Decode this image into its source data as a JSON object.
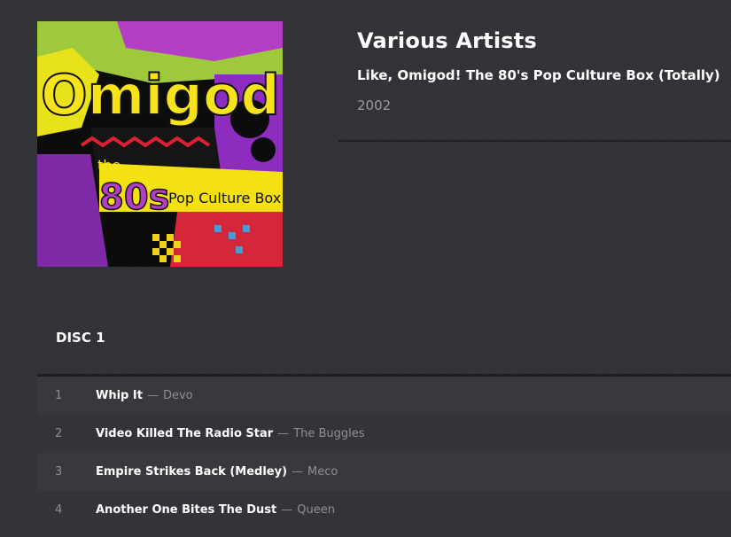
{
  "album": {
    "artist": "Various Artists",
    "title": "Like, Omigod! The 80's Pop Culture Box (Totally)",
    "year": "2002",
    "cover_text": {
      "main": "Omigod!",
      "the": "the",
      "eighties": "80s",
      "box": "Pop Culture Box"
    }
  },
  "disc": {
    "label": "DISC 1",
    "separator": "—",
    "tracks": [
      {
        "number": "1",
        "title": "Whip It",
        "artist": "Devo"
      },
      {
        "number": "2",
        "title": "Video Killed The Radio Star",
        "artist": "The Buggles"
      },
      {
        "number": "3",
        "title": "Empire Strikes Back (Medley)",
        "artist": "Meco"
      },
      {
        "number": "4",
        "title": "Another One Bites The Dust",
        "artist": "Queen"
      }
    ]
  }
}
